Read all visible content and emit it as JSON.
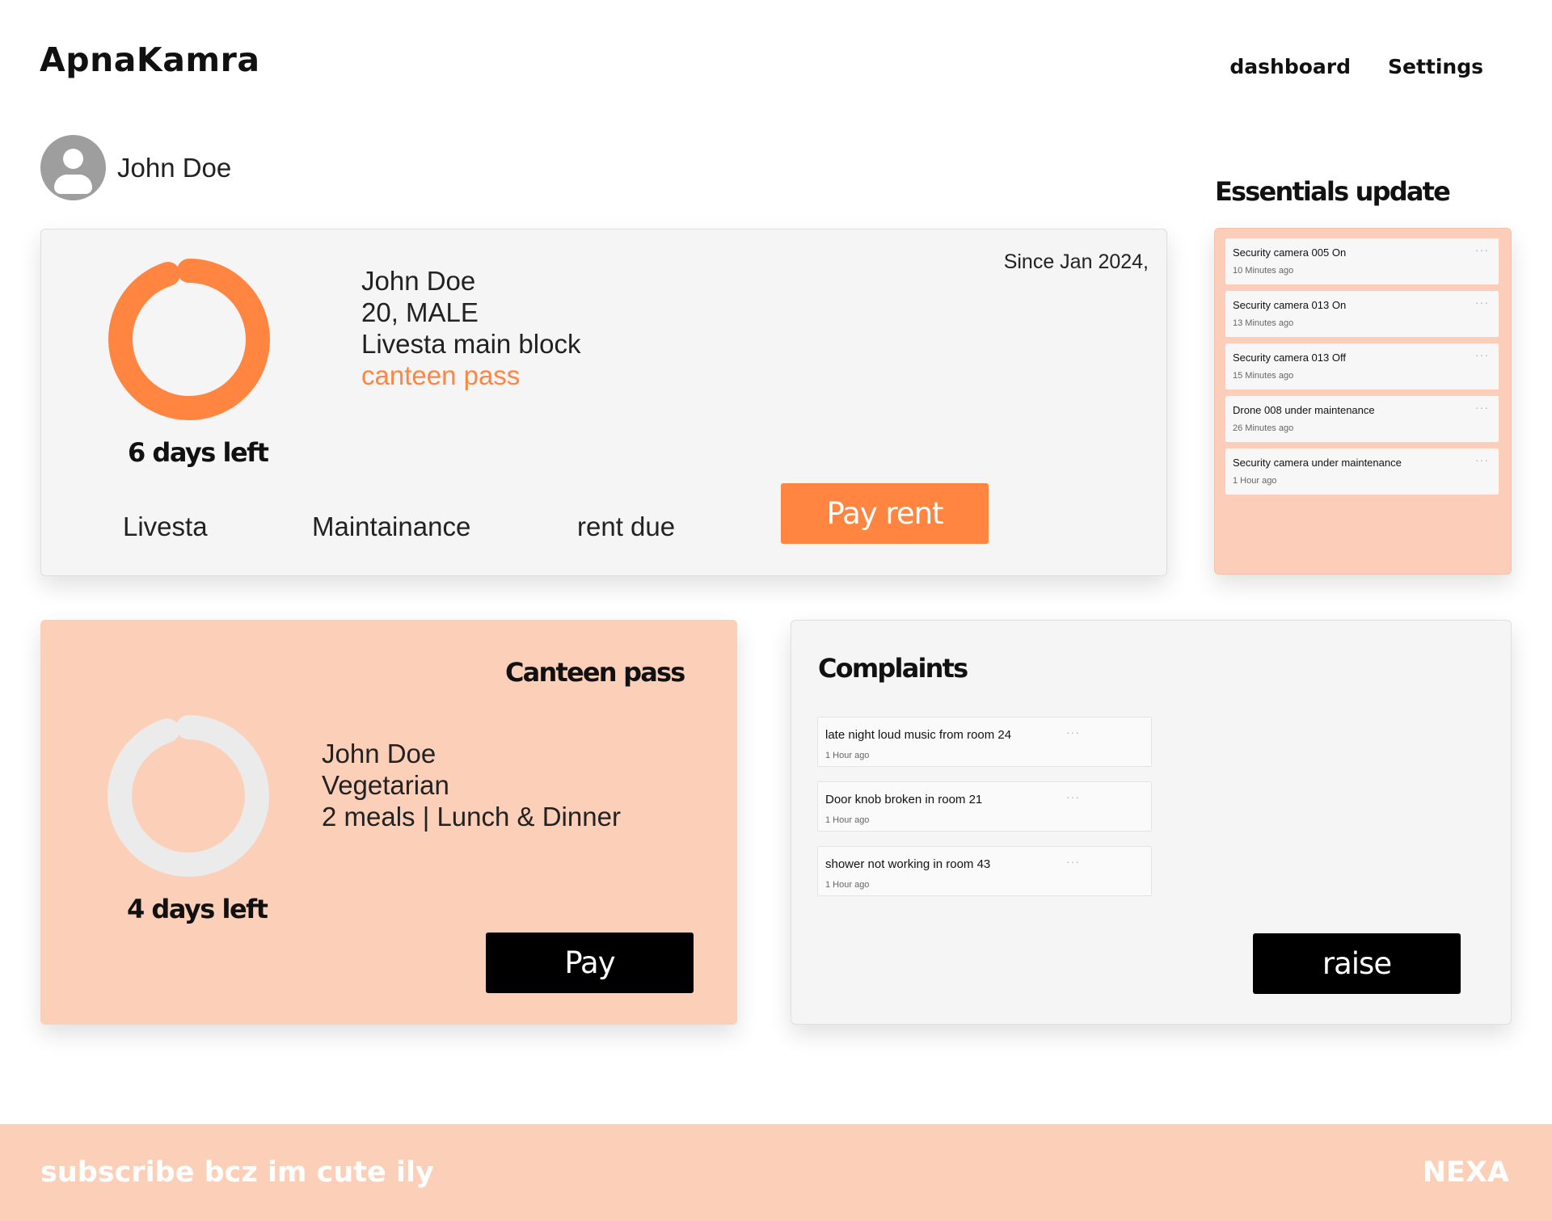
{
  "app": {
    "title": "ApnaKamra"
  },
  "nav": {
    "dashboard": "dashboard",
    "settings": "Settings"
  },
  "user": {
    "name": "John Doe"
  },
  "rent_card": {
    "days_left": "6 days left",
    "days_left_fraction": 0.95,
    "name": "John Doe",
    "age_gender": "20, MALE",
    "block": "Livesta main block",
    "pass": "canteen pass",
    "since": "Since Jan 2024,",
    "col1": "Livesta",
    "col2": "Maintainance",
    "col3": "rent due",
    "pay_label": "Pay rent"
  },
  "essentials": {
    "title": "Essentials update",
    "items": [
      {
        "title": "Security camera 005 On",
        "time": "10 Minutes ago"
      },
      {
        "title": "Security camera 013 On",
        "time": "13 Minutes ago"
      },
      {
        "title": "Security camera 013 Off",
        "time": "15 Minutes ago"
      },
      {
        "title": "Drone 008 under maintenance",
        "time": "26 Minutes ago"
      },
      {
        "title": "Security camera under maintenance",
        "time": "1 Hour ago"
      }
    ],
    "more_glyph": "···"
  },
  "canteen": {
    "title": "Canteen pass",
    "days_left": "4 days left",
    "days_left_fraction": 0.95,
    "name": "John Doe",
    "diet": "Vegetarian",
    "meals": "2 meals | Lunch & Dinner",
    "pay_label": "Pay"
  },
  "complaints": {
    "title": "Complaints",
    "items": [
      {
        "title": "late night loud music from room 24",
        "time": "1 Hour ago"
      },
      {
        "title": "Door knob broken in room 21",
        "time": "1 Hour ago"
      },
      {
        "title": "shower not working in room 43",
        "time": "1 Hour ago"
      }
    ],
    "raise_label": "raise"
  },
  "footer": {
    "left": "subscribe bcz im cute ily",
    "right": "NEXA"
  },
  "colors": {
    "accent": "#ff8540",
    "peach": "#fccfb9",
    "due_red": "#e8192c",
    "ring_gray": "#ebebeb"
  }
}
